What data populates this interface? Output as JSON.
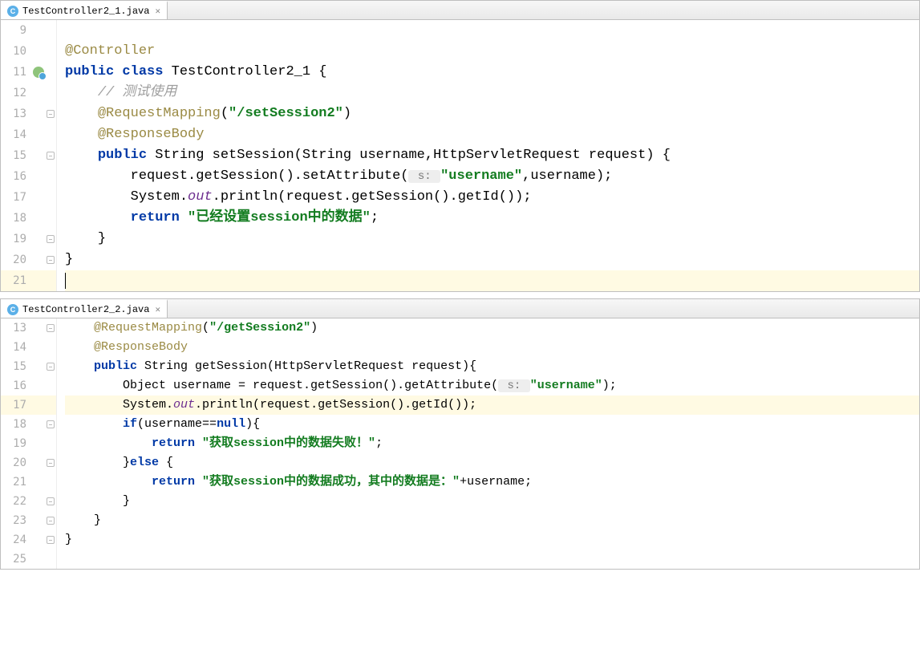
{
  "pane1": {
    "tab": {
      "icon_letter": "C",
      "filename": "TestController2_1.java"
    },
    "line_numbers": [
      "9",
      "10",
      "11",
      "12",
      "13",
      "14",
      "15",
      "16",
      "17",
      "18",
      "19",
      "20",
      "21"
    ],
    "tokens": {
      "l10_ann": "@Controller",
      "l11_kw1": "public",
      "l11_kw2": "class",
      "l11_name": " TestController2_1 {",
      "l12_cmt": "// 测试使用",
      "l13_ann": "@RequestMapping",
      "l13_paren_open": "(",
      "l13_str": "\"/setSession2\"",
      "l13_paren_close": ")",
      "l14_ann": "@ResponseBody",
      "l15_kw": "public",
      "l15_rest": " String setSession(String username,HttpServletRequest request) {",
      "l16_pre": "request.getSession().setAttribute(",
      "l16_hint": " s: ",
      "l16_str": "\"username\"",
      "l16_post": ",username);",
      "l17_pre": "System.",
      "l17_field": "out",
      "l17_post": ".println(request.getSession().getId());",
      "l18_kw": "return",
      "l18_str": " \"已经设置session中的数据\"",
      "l18_semi": ";",
      "l19_brace": "}",
      "l20_brace": "}"
    }
  },
  "pane2": {
    "tab": {
      "icon_letter": "C",
      "filename": "TestController2_2.java"
    },
    "line_numbers": [
      "13",
      "14",
      "15",
      "16",
      "17",
      "18",
      "19",
      "20",
      "21",
      "22",
      "23",
      "24",
      "25"
    ],
    "tokens": {
      "l13_ann": "@RequestMapping",
      "l13_paren_open": "(",
      "l13_str": "\"/getSession2\"",
      "l13_paren_close": ")",
      "l14_ann": "@ResponseBody",
      "l15_kw": "public",
      "l15_rest": " String getSession(HttpServletRequest request){",
      "l16_pre": "Object username = request.getSession().getAttribute(",
      "l16_hint": " s: ",
      "l16_str": "\"username\"",
      "l16_post": ");",
      "l17_pre": "System.",
      "l17_field": "out",
      "l17_post": ".println(request.getSession().getId());",
      "l18_kw": "if",
      "l18_rest": "(username==",
      "l18_null": "null",
      "l18_brace": "){",
      "l19_kw": "return",
      "l19_str": " \"获取session中的数据失败！\"",
      "l19_semi": ";",
      "l20_close": "}",
      "l20_kw": "else",
      "l20_brace": " {",
      "l21_kw": "return",
      "l21_str": " \"获取session中的数据成功，其中的数据是：\"",
      "l21_post": "+username;",
      "l22_brace": "}",
      "l23_brace": "}",
      "l24_brace": "}"
    }
  }
}
